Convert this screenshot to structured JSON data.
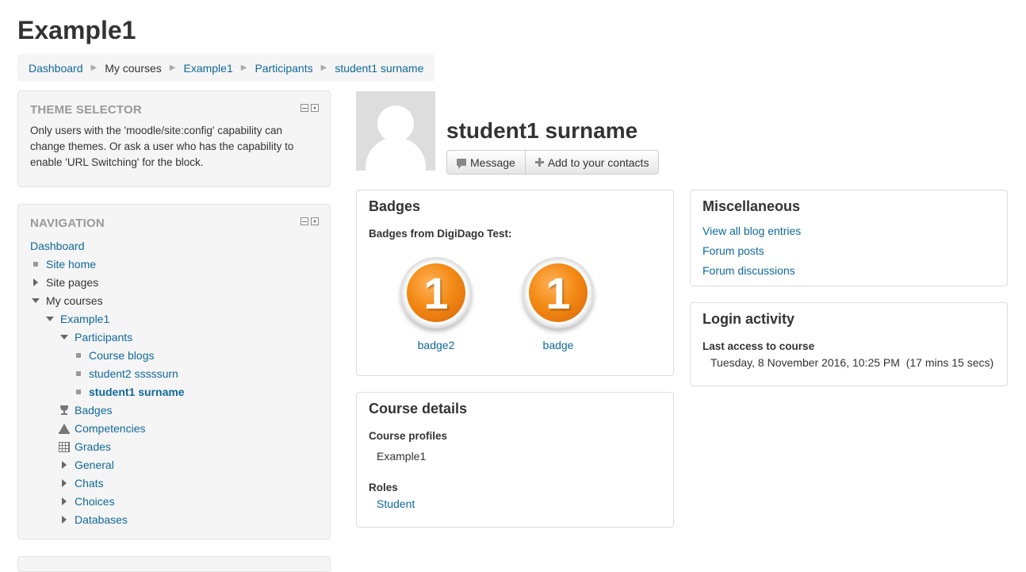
{
  "page": {
    "course_title": "Example1"
  },
  "breadcrumb": [
    {
      "label": "Dashboard",
      "link": true
    },
    {
      "label": "My courses",
      "link": false
    },
    {
      "label": "Example1",
      "link": true
    },
    {
      "label": "Participants",
      "link": true
    },
    {
      "label": "student1 surname",
      "link": true
    }
  ],
  "theme_block": {
    "title": "THEME SELECTOR",
    "text": "Only users with the 'moodle/site:config' capability can change themes. Or ask a user who has the capability to enable 'URL Switching' for the block."
  },
  "navigation": {
    "title": "NAVIGATION",
    "items": [
      {
        "label": "Dashboard",
        "level": 0,
        "icon": "none",
        "link": true
      },
      {
        "label": "Site home",
        "level": 0,
        "icon": "bullet",
        "link": true
      },
      {
        "label": "Site pages",
        "level": 0,
        "icon": "collapsed",
        "link": false
      },
      {
        "label": "My courses",
        "level": 0,
        "icon": "expanded",
        "link": false
      },
      {
        "label": "Example1",
        "level": 1,
        "icon": "expanded",
        "link": true
      },
      {
        "label": "Participants",
        "level": 2,
        "icon": "expanded",
        "link": true
      },
      {
        "label": "Course blogs",
        "level": 3,
        "icon": "bullet",
        "link": true
      },
      {
        "label": "student2 sssssurn",
        "level": 3,
        "icon": "bullet",
        "link": true
      },
      {
        "label": "student1 surname",
        "level": 3,
        "icon": "bullet",
        "link": true,
        "active": true
      },
      {
        "label": "Badges",
        "level": 2,
        "icon": "trophy",
        "link": true
      },
      {
        "label": "Competencies",
        "level": 2,
        "icon": "competency",
        "link": true
      },
      {
        "label": "Grades",
        "level": 2,
        "icon": "grid",
        "link": true
      },
      {
        "label": "General",
        "level": 2,
        "icon": "collapsed",
        "link": true
      },
      {
        "label": "Chats",
        "level": 2,
        "icon": "collapsed",
        "link": true
      },
      {
        "label": "Choices",
        "level": 2,
        "icon": "collapsed",
        "link": true
      },
      {
        "label": "Databases",
        "level": 2,
        "icon": "collapsed",
        "link": true
      }
    ]
  },
  "profile": {
    "full_name": "student1 surname",
    "message_label": "Message",
    "add_contact_label": "Add to your contacts"
  },
  "badges": {
    "title": "Badges",
    "subtitle": "Badges from DigiDago Test:",
    "items": [
      {
        "label": "badge2",
        "numeral": "1"
      },
      {
        "label": "badge",
        "numeral": "1"
      }
    ]
  },
  "course_details": {
    "title": "Course details",
    "profiles_label": "Course profiles",
    "profiles_value": "Example1",
    "roles_label": "Roles",
    "roles_value": "Student"
  },
  "miscellaneous": {
    "title": "Miscellaneous",
    "links": [
      "View all blog entries",
      "Forum posts",
      "Forum discussions"
    ]
  },
  "login_activity": {
    "title": "Login activity",
    "last_access_label": "Last access to course",
    "last_access_value": "Tuesday, 8 November 2016, 10:25 PM  (17 mins 15 secs)"
  },
  "colors": {
    "link": "#0f6999",
    "block_bg": "#f5f5f5",
    "badge_orange": "#f38a14"
  }
}
